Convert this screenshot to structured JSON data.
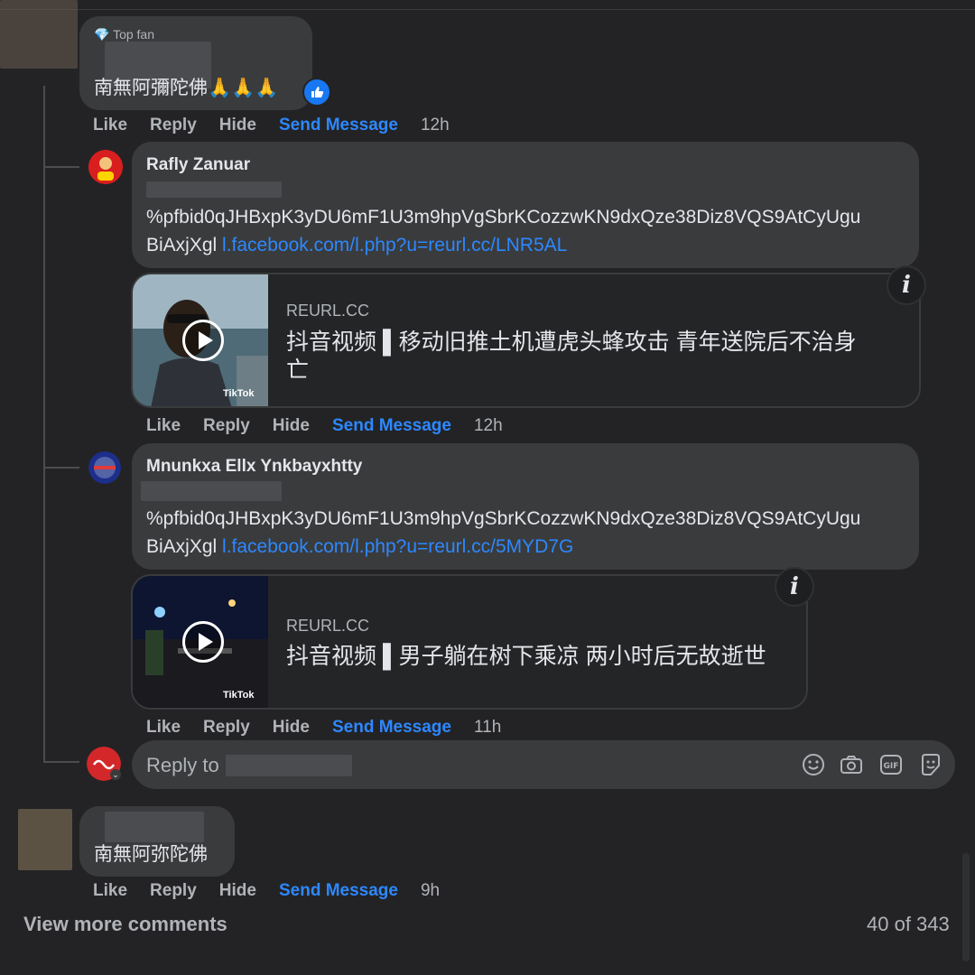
{
  "comment1": {
    "badge": "Top fan",
    "text": "南無阿彌陀佛",
    "emoji": "🙏🙏🙏"
  },
  "comment2": {
    "author": "Rafly Zanuar",
    "text": "%pfbid0qJHBxpK3yDU6mF1U3m9hpVgSbrKCozzwKN9dxQze38Diz8VQS9AtCyUgu",
    "text2": "BiAxjXgl",
    "link": "l.facebook.com/l.php?u=reurl.cc/LNR5AL",
    "card": {
      "domain": "REURL.CC",
      "title_line1": "抖音视频 ▌移动旧推土机遭虎头蜂攻击 青年送院后不治身",
      "title_line2": "亡",
      "tiktok": "TikTok"
    }
  },
  "comment3": {
    "author": "Mnunkxa Ellx Ynkbayxhtty",
    "text": "%pfbid0qJHBxpK3yDU6mF1U3m9hpVgSbrKCozzwKN9dxQze38Diz8VQS9AtCyUgu",
    "text2": "BiAxjXgl",
    "link": "l.facebook.com/l.php?u=reurl.cc/5MYD7G",
    "card": {
      "domain": "REURL.CC",
      "title": "抖音视频 ▌男子躺在树下乘凉 两小时后无故逝世",
      "tiktok": "TikTok"
    }
  },
  "comment4": {
    "text": "南無阿弥陀佛"
  },
  "actions": {
    "like": "Like",
    "reply": "Reply",
    "hide": "Hide",
    "send": "Send Message",
    "times": [
      "12h",
      "12h",
      "11h",
      "9h"
    ]
  },
  "reply_box": {
    "placeholder": "Reply to",
    "icons": [
      "smile-icon",
      "camera-icon",
      "gif-icon",
      "sticker-icon"
    ]
  },
  "footer": {
    "view_more": "View more comments",
    "count": "40 of 343"
  },
  "colors": {
    "background": "#232325",
    "bubble": "#3a3b3c",
    "link": "#2d88ff",
    "muted": "#b0b3b8"
  }
}
